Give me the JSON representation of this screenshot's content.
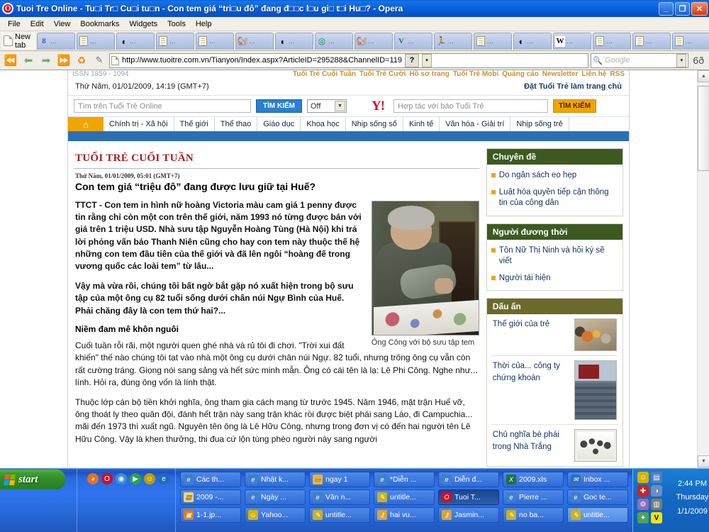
{
  "window": {
    "title": "Tuoi Tre Online - Tu□i Tr□ Cu□i tu□n - Con tem giá “tri□u đô” đang đ□□c l□u gi□ t□i Hu□? - Opera",
    "minimize": "_",
    "maximize": "❐",
    "close": "✕",
    "logo_letter": "O"
  },
  "menu": [
    "File",
    "Edit",
    "View",
    "Bookmarks",
    "Widgets",
    "Tools",
    "Help"
  ],
  "tabs": {
    "new_tab_label": "New tab",
    "items": [
      {
        "icon": "google-icon",
        "glyph": "8",
        "dots": "..."
      },
      {
        "icon": "page-icon",
        "glyph": "",
        "dots": "..."
      },
      {
        "icon": "opera-speeddial-icon",
        "glyph": "",
        "dots": "..."
      },
      {
        "icon": "page-icon",
        "glyph": "",
        "dots": "..."
      },
      {
        "icon": "page-icon",
        "glyph": "",
        "dots": "..."
      },
      {
        "icon": "squirrel-icon",
        "glyph": "",
        "dots": "..."
      },
      {
        "icon": "opera-speeddial-icon",
        "glyph": "",
        "dots": "..."
      },
      {
        "icon": "target-icon",
        "glyph": "",
        "dots": "..."
      },
      {
        "icon": "squirrel-icon",
        "glyph": "",
        "dots": "..."
      },
      {
        "icon": "v-icon",
        "glyph": "V",
        "dots": "..."
      },
      {
        "icon": "runner-icon",
        "glyph": "",
        "dots": "..."
      },
      {
        "icon": "page-icon",
        "glyph": "",
        "dots": "..."
      },
      {
        "icon": "opera-speeddial-icon",
        "glyph": "",
        "dots": "..."
      },
      {
        "icon": "wikipedia-icon",
        "glyph": "W",
        "dots": "..."
      },
      {
        "icon": "page-icon",
        "glyph": "",
        "dots": "..."
      },
      {
        "icon": "page-icon",
        "glyph": "",
        "dots": "..."
      },
      {
        "icon": "page-icon",
        "glyph": "",
        "dots": "..."
      },
      {
        "icon": "google-icon",
        "glyph": "8",
        "dots": "..."
      },
      {
        "icon": "page-icon",
        "glyph": "",
        "dots": "..."
      },
      {
        "icon": "page-icon",
        "glyph": "",
        "dots": "..."
      },
      {
        "icon": "page-icon-active",
        "glyph": "",
        "dots": "✕"
      }
    ],
    "trash_label": "trash-icon"
  },
  "addressbar": {
    "url": "http://www.tuoitre.com.vn/Tianyon/Index.aspx?ArticleID=295288&ChannelID=119",
    "question_button": "?",
    "dropdown": "▾",
    "search_placeholder": "Google",
    "zoom_icon": "glasses-icon"
  },
  "page": {
    "top_strip": {
      "issn": "ISSN 1859 - 1094",
      "links": [
        "Tuổi Trẻ Cuối Tuần",
        "Tuổi Trẻ Cười",
        "Hồ sơ trang",
        "Tuổi Trẻ Mobi",
        "Quảng cáo",
        "Newsletter",
        "Liên hệ"
      ],
      "badge": "RSS"
    },
    "datebar": {
      "date": "Thứ Năm, 01/01/2009, 14:19 (GMT+7)",
      "homepage_link": "Đặt Tuổi Trẻ làm trang chủ"
    },
    "searchbar": {
      "site_search_placeholder": "Tìm trên Tuổi Trẻ Online",
      "site_search_button": "TÌM KIẾM",
      "filter_value": "Off",
      "yahoo_logo": "Y!",
      "partner_placeholder": "Hợp tác với báo Tuổi Trẻ",
      "partner_button": "TÌM KIẾM"
    },
    "nav": {
      "home_icon": "home-icon",
      "items": [
        "Chính trị - Xã hội",
        "Thế giới",
        "Thể thao",
        "Giáo dục",
        "Khoa học",
        "Nhịp sống số",
        "Kinh tế",
        "Văn hóa - Giải trí",
        "Nhịp sống trẻ"
      ]
    },
    "article": {
      "brand": "TUỔI TRẺ CUỐI TUẦN",
      "date": "Thứ Năm, 01/01/2009, 05:01 (GMT+7)",
      "title": "Con tem giá “triệu đô” đang được lưu giữ tại Huế?",
      "lead": "TTCT - Con tem in hình nữ hoàng Victoria màu cam giá 1 penny được tin rằng chỉ còn một con trên thế giới, năm 1993 nó từng được bán với giá trên 1 triệu USD. Nhà sưu tập Nguyễn Hoàng Tùng (Hà Nội) khi trả lời phỏng vấn báo Thanh Niên cũng cho hay con tem này thuộc thế hệ những con tem đầu tiên của thế giới và đã lên ngôi “hoàng đế trong vương quốc các loài tem” từ lâu...",
      "para2": "Vậy mà vừa rồi, chúng tôi bất ngờ bắt gặp nó xuất hiện trong bộ sưu tập của một ông cụ 82 tuổi sống dưới chân núi Ngự Bình của Huế. Phải chăng đây là con tem thứ hai?...",
      "subhead": "Niềm đam mê khôn nguôi",
      "para3": "Cuối tuần rỗi rãi, một người quen ghé nhà và rủ tôi đi chơi. \"Trời xui đất khiến\" thế nào chúng tôi tạt vào nhà một ông cụ dưới chân núi Ngự. 82 tuổi, nhưng trông ông cụ vẫn còn rất cường tráng. Giọng nói sang sảng và hết sức minh mẫn. Ông có cái tên là lạ: Lê Phi Công. Nghe như... lính. Hỏi ra, đúng ông vốn là lính thật.",
      "para4": "Thuộc lớp cán bộ tiền khởi nghĩa, ông tham gia cách mạng từ trước 1945. Năm 1946, mặt trận Huế vỡ, ông thoát ly theo quân đội, đánh hết trận này sang trận khác rồi được biệt phái sang Lào, đi Campuchia... mãi đến 1973 thì xuất ngũ. Nguyên tên ông là Lê Hữu Công, nhưng trong đơn vị có đến hai người tên Lê Hữu Công. Vậy là khen thưởng, thi đua cứ lộn tùng phèo người này sang người",
      "photo_caption": "Ông Công với bộ sưu tập tem",
      "photo_alt": "elderly-man-with-stamp-collection-photo"
    },
    "sidebar": [
      {
        "title": "Chuyên đề",
        "style": "green",
        "links": [
          "Do ngân sách eo hẹp",
          "Luật hóa quyền tiếp cận thông tin của công dân"
        ]
      },
      {
        "title": "Người đương thời",
        "style": "green",
        "links": [
          "Tôn Nữ Thị Ninh và hồi ký sẽ viết",
          "Người tái hiện"
        ]
      },
      {
        "title": "Dấu ấn",
        "style": "olive",
        "rows": [
          {
            "text": "Thế giới của trẻ",
            "thumb": "th1"
          },
          {
            "text": "Thời của... công ty chứng khoán",
            "thumb": "th2"
          },
          {
            "text": "Chủ nghĩa bè phái trong Nhà Trắng",
            "thumb": "th3"
          }
        ]
      }
    ]
  },
  "taskbar": {
    "start_label": "start",
    "quicklaunch": [
      {
        "name": "firefox-icon",
        "glyph": "◕",
        "color": "#e8701a"
      },
      {
        "name": "opera-icon",
        "glyph": "O",
        "color": "#c9112b"
      },
      {
        "name": "media-icon",
        "glyph": "◉",
        "color": "#3b8fd6"
      },
      {
        "name": "player-icon",
        "glyph": "▶",
        "color": "#2ba34a"
      },
      {
        "name": "yahoo-messenger-icon",
        "glyph": "☺",
        "color": "#b9a000"
      },
      {
        "name": "internet-explorer-icon",
        "glyph": "e",
        "color": "#1f6bc0"
      }
    ],
    "rows": [
      [
        {
          "label": "Các th...",
          "icon": "ie-doc-icon",
          "state": "normal"
        },
        {
          "label": "Nhật k...",
          "icon": "ie-doc-icon",
          "state": "normal"
        },
        {
          "label": "ngay 1",
          "icon": "folder-icon",
          "state": "normal"
        },
        {
          "label": "*Diễn ...",
          "icon": "ie-doc-icon",
          "state": "normal"
        },
        {
          "label": "Diễn đ...",
          "icon": "ie-doc-icon",
          "state": "normal"
        },
        {
          "label": "2009.xls",
          "icon": "excel-icon",
          "state": "normal"
        },
        {
          "label": "Inbox ...",
          "icon": "mail-icon",
          "state": "normal"
        }
      ],
      [
        {
          "label": "2009 -...",
          "icon": "note-icon",
          "state": "normal"
        },
        {
          "label": "Ngày ...",
          "icon": "ie-doc-icon",
          "state": "normal"
        },
        {
          "label": "Văn n...",
          "icon": "ie-doc-icon",
          "state": "normal"
        },
        {
          "label": "untitle...",
          "icon": "paint-icon",
          "state": "normal"
        },
        {
          "label": "Tuoi T...",
          "icon": "opera-icon",
          "state": "active"
        },
        {
          "label": "Pierre ...",
          "icon": "ie-doc-icon",
          "state": "normal"
        },
        {
          "label": "Goc te...",
          "icon": "ie-doc-icon",
          "state": "normal"
        }
      ],
      [
        {
          "label": "1-1.jp...",
          "icon": "image-icon",
          "state": "normal"
        },
        {
          "label": "Yahoo...",
          "icon": "yahoo-messenger-icon",
          "state": "normal"
        },
        {
          "label": "untitle...",
          "icon": "paint-icon",
          "state": "normal"
        },
        {
          "label": "hai vu...",
          "icon": "key-icon",
          "state": "normal"
        },
        {
          "label": "Jasmin...",
          "icon": "key-icon",
          "state": "normal"
        },
        {
          "label": "no ba...",
          "icon": "paint-icon",
          "state": "normal"
        },
        {
          "label": "untitle...",
          "icon": "paint-icon",
          "state": "hot"
        }
      ]
    ],
    "tray_icons": [
      {
        "name": "yahoo-messenger-tray-icon",
        "glyph": "☺",
        "color": "#d6b400"
      },
      {
        "name": "network-tray-icon",
        "glyph": "🖳",
        "color": "#4f7fc0"
      },
      {
        "name": "antivirus-tray-icon",
        "glyph": "✚",
        "color": "#cc2222"
      },
      {
        "name": "volume-tray-icon",
        "glyph": "◑",
        "color": "#6a8fc0"
      },
      {
        "name": "updates-tray-icon",
        "glyph": "⚙",
        "color": "#8a6fc0"
      },
      {
        "name": "webcam-tray-icon",
        "glyph": "📷",
        "color": "#7a7a7a"
      },
      {
        "name": "settings-tray-icon",
        "glyph": "✦",
        "color": "#4fa05a"
      },
      {
        "name": "unikey-tray-icon",
        "glyph": "V",
        "color": "#f2e400"
      }
    ],
    "clock": {
      "time": "2:44 PM",
      "day": "Thursday",
      "date": "1/1/2009"
    }
  }
}
